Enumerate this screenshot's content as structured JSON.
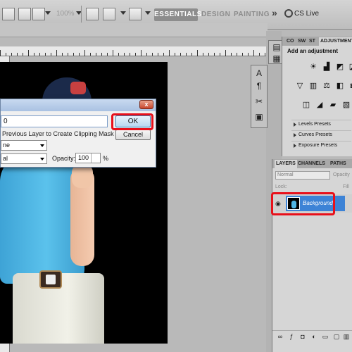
{
  "toolbar": {
    "zoom": "100%",
    "workspaces": [
      "ESSENTIALS",
      "DESIGN",
      "PAINTING"
    ],
    "more": "»",
    "cs_live": "CS Live"
  },
  "dialog": {
    "name_value": "0",
    "clip_label": "Previous Layer to Create Clipping Mask",
    "color_value": "ne",
    "mode_value": "al",
    "opacity_label": "Opacity:",
    "opacity_value": "100",
    "opacity_unit": "%",
    "ok_label": "OK",
    "cancel_label": "Cancel",
    "close_glyph": "x"
  },
  "adjustments": {
    "tabs": [
      "CO",
      "SW",
      "ST",
      "ADJUSTMENTS"
    ],
    "title": "Add an adjustment",
    "presets": [
      "Levels Presets",
      "Curves Presets",
      "Exposure Presets"
    ]
  },
  "layers": {
    "tabs": [
      "LAYERS",
      "CHANNELS",
      "PATHS"
    ],
    "blend_mode": "Normal",
    "opacity_label": "Opacity",
    "lock_label": "Lock:",
    "fill_label": "Fill",
    "layer_name": "Background"
  },
  "colors": {
    "highlight": "#e8101a",
    "selection": "#3d83d6"
  }
}
